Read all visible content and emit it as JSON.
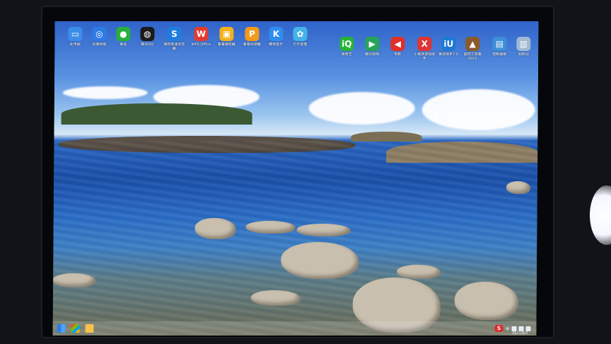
{
  "desktop": {
    "icons": [
      {
        "id": "this-pc",
        "label": "此电脑",
        "glyph": "▭",
        "color": "#3b8ee8"
      },
      {
        "id": "baidu-netdisk",
        "label": "百度网盘",
        "glyph": "◎",
        "color": "#2f7be6"
      },
      {
        "id": "wechat",
        "label": "微信",
        "glyph": "●",
        "color": "#2aae3c"
      },
      {
        "id": "qq",
        "label": "腾讯QQ",
        "glyph": "◍",
        "color": "#1b1b1b"
      },
      {
        "id": "browser",
        "label": "搜狗高速浏览器",
        "glyph": "S",
        "color": "#1f7de0"
      },
      {
        "id": "wps",
        "label": "WPS Office",
        "glyph": "W",
        "color": "#e33b2e"
      },
      {
        "id": "video-player",
        "label": "看看播放器",
        "glyph": "▣",
        "color": "#f2b01a"
      },
      {
        "id": "pdf-reader",
        "label": "看看阅读器",
        "glyph": "P",
        "color": "#f39a1a"
      },
      {
        "id": "kugou",
        "label": "酷我音乐",
        "glyph": "K",
        "color": "#2f8df0"
      },
      {
        "id": "pinwheel",
        "label": "打开管理",
        "glyph": "✿",
        "color": "#43b3e8"
      },
      {
        "id": "iqiyi",
        "label": "爱奇艺",
        "glyph": "iQ",
        "color": "#27b33a"
      },
      {
        "id": "tencent-video",
        "label": "腾讯视频",
        "glyph": "▶",
        "color": "#27a35a"
      },
      {
        "id": "youku",
        "label": "电影",
        "glyph": "◀",
        "color": "#e0302a"
      },
      {
        "id": "xiaomi",
        "label": "小黑侠游戏助手",
        "glyph": "X",
        "color": "#e03434"
      },
      {
        "id": "uu",
        "label": "爱思助手7.0",
        "glyph": "iU",
        "color": "#1f78d6"
      },
      {
        "id": "toolbox",
        "label": "图吧工具箱2021",
        "glyph": "▲",
        "color": "#8a5a2c"
      },
      {
        "id": "control-panel",
        "label": "控制面板",
        "glyph": "▤",
        "color": "#3d8fd8"
      },
      {
        "id": "recycle-bin",
        "label": "回收站",
        "glyph": "▥",
        "color": "#9fb8d4"
      }
    ]
  },
  "taskbar": {
    "tray_badge": "S",
    "tray_lang": "中",
    "date": "2021/8/5"
  }
}
